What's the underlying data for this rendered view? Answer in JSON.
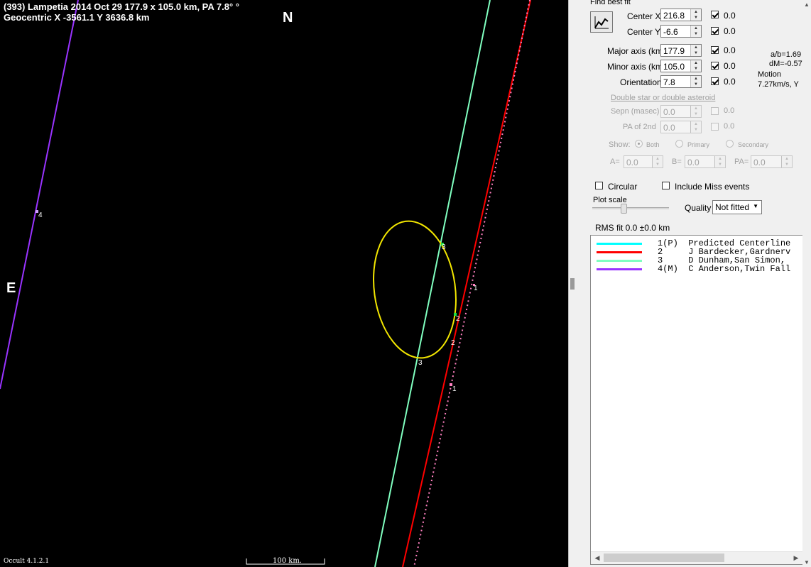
{
  "plot": {
    "header_line1": "(393) Lampetia  2014 Oct 29   177.9 x 105.0 km, PA 7.8° °",
    "header_line2": "Geocentric  X  -3561.1  Y 3636.8 km",
    "north_label": "N",
    "east_label": "E",
    "version": "Occult 4.1.2.1",
    "scale_label": "100 km.",
    "chord_labels": [
      "1",
      "1",
      "2",
      "2",
      "3",
      "3",
      "4"
    ],
    "colors": {
      "background": "#000000",
      "ellipse": "#f2e600",
      "chord1": "#ff80c0",
      "chord2": "#ff0000",
      "chord3": "#80ffc0",
      "chord4": "#9933ff"
    }
  },
  "panel": {
    "find_best_fit": "Find best fit",
    "center_x": {
      "label": "Center X",
      "value": "216.8",
      "check": "0.0"
    },
    "center_y": {
      "label": "Center Y",
      "value": "-6.6",
      "check": "0.0"
    },
    "major_axis": {
      "label": "Major axis (km)",
      "value": "177.9",
      "check": "0.0"
    },
    "minor_axis": {
      "label": "Minor axis (km)",
      "value": "105.0",
      "check": "0.0"
    },
    "orientation": {
      "label": "Orientation",
      "value": "7.8",
      "check": "0.0"
    },
    "ab_ratio": "a/b=1.69",
    "dm": "dM=-0.57",
    "motion_label": "Motion",
    "motion_value": "7.27km/s, Y",
    "double_star": "Double star  or  double asteroid",
    "sepn": {
      "label": "Sepn (masec)",
      "value": "0.0",
      "check": "0.0"
    },
    "pa2nd": {
      "label": "PA of 2nd",
      "value": "0.0",
      "check": "0.0"
    },
    "show_label": "Show:",
    "show_both": "Both",
    "show_primary": "Primary",
    "show_secondary": "Secondary",
    "a_label": "A=",
    "a_value": "0.0",
    "b_label": "B=",
    "b_value": "0.0",
    "pa_label": "PA=",
    "pa_value": "0.0",
    "circular": "Circular",
    "include_miss": "Include Miss events",
    "plot_scale": "Plot scale",
    "quality_label": "Quality",
    "quality_value": "Not fitted",
    "rms_fit": "RMS fit  0.0 ±0.0 km",
    "legend": [
      {
        "text": "1(P)  Predicted Centerline",
        "color": "#00ffff"
      },
      {
        "text": "2     J Bardecker,Gardnerv",
        "color": "#ff0000"
      },
      {
        "text": "3     D Dunham,San Simon,",
        "color": "#80ffc0"
      },
      {
        "text": "4(M)  C Anderson,Twin Fall",
        "color": "#9933ff"
      }
    ]
  }
}
